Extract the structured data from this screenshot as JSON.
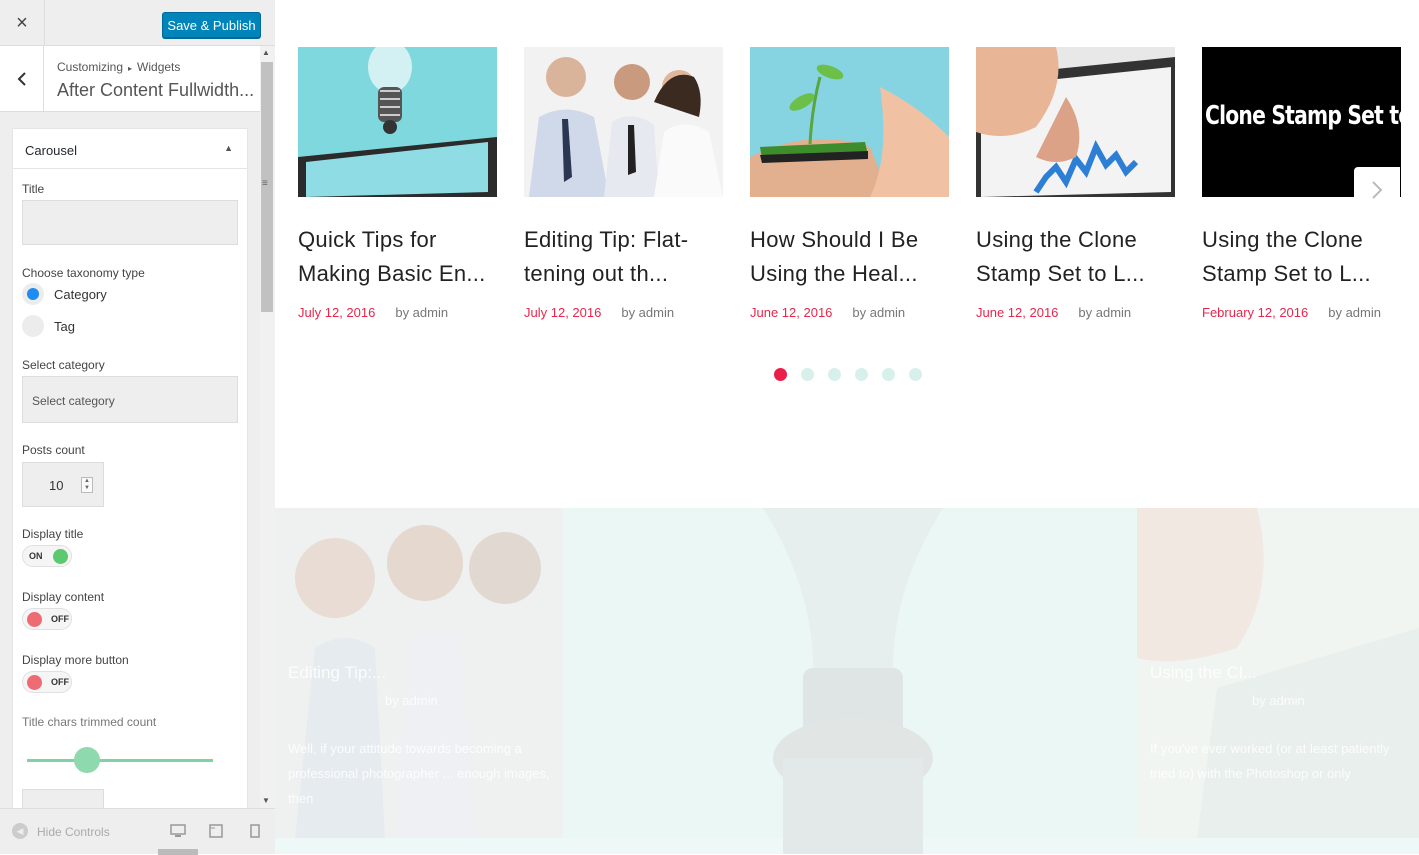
{
  "sidebar": {
    "close_label": "×",
    "publish_label": "Save & Publish",
    "back_label": "‹",
    "breadcrumb": {
      "root": "Customizing",
      "sep": "▸",
      "section": "Widgets"
    },
    "panel_title": "After Content Fullwidth...",
    "widget": {
      "title": "Carousel",
      "toggle_arrow": "▲",
      "fields": {
        "title_label": "Title",
        "title_value": "",
        "taxonomy_label": "Choose taxonomy type",
        "taxonomy_options": [
          {
            "label": "Category",
            "selected": true
          },
          {
            "label": "Tag",
            "selected": false
          }
        ],
        "category_label": "Select category",
        "category_placeholder": "Select category",
        "posts_count_label": "Posts count",
        "posts_count_value": "10",
        "display_title_label": "Display title",
        "display_title_state": "ON",
        "display_content_label": "Display content",
        "display_content_state": "OFF",
        "display_more_label": "Display more button",
        "display_more_state": "OFF",
        "trim_label": "Title chars trimmed count",
        "trim_slider_fraction": 0.32
      }
    },
    "footer": {
      "hide_controls_label": "Hide Controls",
      "devices": [
        "desktop-icon",
        "tablet-icon",
        "mobile-icon"
      ]
    }
  },
  "preview": {
    "carousel": [
      {
        "title": "Quick Tips for Making Basic En...",
        "date": "July 12, 2016",
        "author": "by admin",
        "image": "lightbulb-tablet"
      },
      {
        "title": "Editing Tip: Flat-tening out th...",
        "date": "July 12, 2016",
        "author": "by admin",
        "image": "business-meeting"
      },
      {
        "title": "How Should I Be Using the Heal...",
        "date": "June 12, 2016",
        "author": "by admin",
        "image": "plant-on-phone"
      },
      {
        "title": "Using the Clone Stamp Set to L...",
        "date": "June 12, 2016",
        "author": "by admin",
        "image": "tablet-chart"
      },
      {
        "title": "Using the Clone Stamp Set to L...",
        "date": "February 12, 2016",
        "author": "by admin",
        "image": "clone-stamp-text"
      }
    ],
    "clone_stamp_image_text": "Clone Stamp Set to",
    "dots": 6,
    "active_dot": 0,
    "lower": {
      "left_title": "Editing Tip:...",
      "left_meta": "by admin",
      "left_excerpt": "Well, if your attitude towards becoming a professional photographer ... enough images, then",
      "right_title": "Using the Cl...",
      "right_meta": "by admin",
      "right_excerpt": "If you've ever worked (or at least patiently tried to) with the Photoshop or only"
    },
    "colors": {
      "accent": "#ea1e49",
      "dot_inactive": "#d8f0ec",
      "publish": "#0085ba"
    }
  }
}
